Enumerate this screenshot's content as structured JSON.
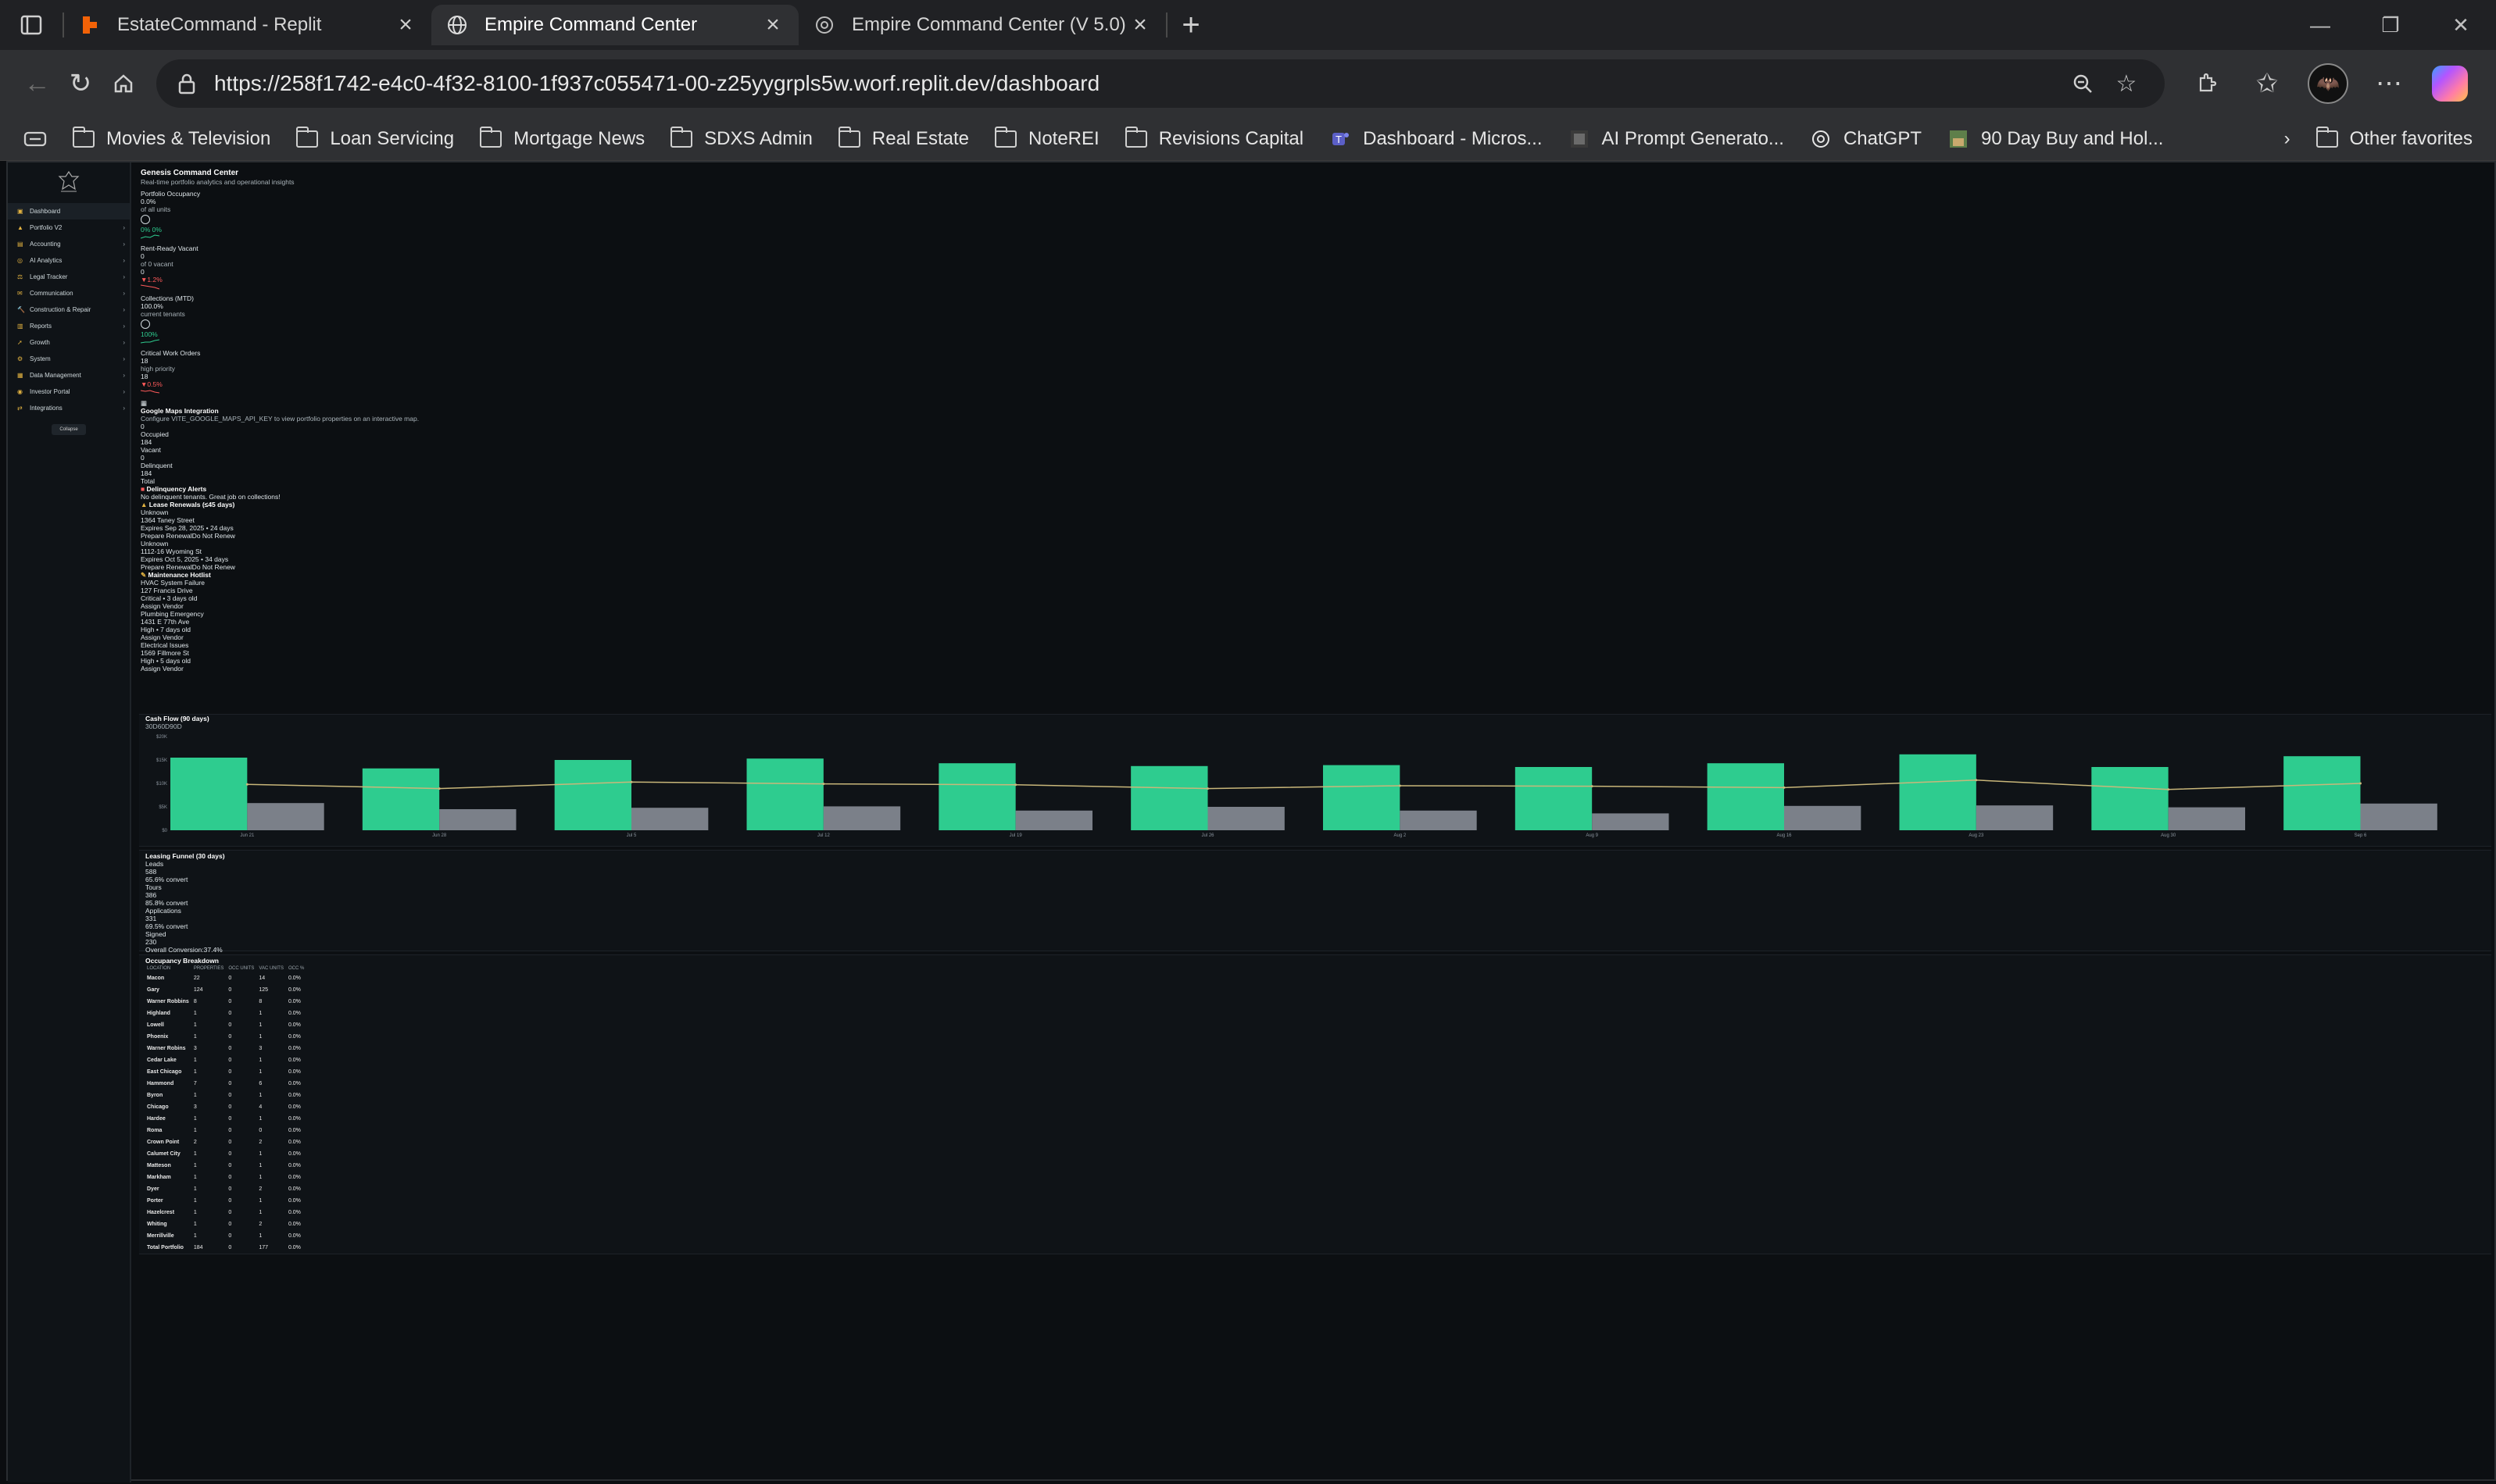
{
  "browser": {
    "tabs": [
      {
        "title": "EstateCommand - Replit",
        "active": false,
        "favicon": "replit-icon"
      },
      {
        "title": "Empire Command Center",
        "active": true,
        "favicon": "globe-icon"
      },
      {
        "title": "Empire Command Center (V 5.0)",
        "active": false,
        "favicon": "openai-icon"
      }
    ],
    "url": "https://258f1742-e4c0-4f32-8100-1f937c055471-00-z25yygrpls5w.worf.replit.dev/dashboard",
    "bookmarks": [
      {
        "label": "Movies & Television",
        "icon": "folder-icon"
      },
      {
        "label": "Loan Servicing",
        "icon": "folder-icon"
      },
      {
        "label": "Mortgage News",
        "icon": "folder-icon"
      },
      {
        "label": "SDXS Admin",
        "icon": "folder-icon"
      },
      {
        "label": "Real Estate",
        "icon": "folder-icon"
      },
      {
        "label": "NoteREI",
        "icon": "folder-icon"
      },
      {
        "label": "Revisions Capital",
        "icon": "folder-icon"
      },
      {
        "label": "Dashboard - Micros...",
        "icon": "teams-icon"
      },
      {
        "label": "AI Prompt Generato...",
        "icon": "image-icon"
      },
      {
        "label": "ChatGPT",
        "icon": "openai-icon"
      },
      {
        "label": "90 Day Buy and Hol...",
        "icon": "image-icon"
      }
    ],
    "other_favorites": "Other favorites"
  },
  "sidebar": {
    "items": [
      {
        "label": "Dashboard",
        "has_children": false
      },
      {
        "label": "Portfolio V2",
        "has_children": true
      },
      {
        "label": "Accounting",
        "has_children": true
      },
      {
        "label": "AI Analytics",
        "has_children": true
      },
      {
        "label": "Legal Tracker",
        "has_children": true
      },
      {
        "label": "Communication",
        "has_children": true
      },
      {
        "label": "Construction & Repair",
        "has_children": true
      },
      {
        "label": "Reports",
        "has_children": true
      },
      {
        "label": "Growth",
        "has_children": true
      },
      {
        "label": "System",
        "has_children": true
      },
      {
        "label": "Data Management",
        "has_children": true
      },
      {
        "label": "Investor Portal",
        "has_children": true
      },
      {
        "label": "Integrations",
        "has_children": true
      }
    ],
    "collapse_label": "Collapse"
  },
  "header": {
    "title": "Genesis Command Center",
    "subtitle": "Real-time portfolio analytics and operational insights"
  },
  "metrics": {
    "occupancy": {
      "label": "Portfolio Occupancy",
      "value": "0.0%",
      "sub": "of all units",
      "delta": "0%",
      "delta_pct": "0%"
    },
    "rent_ready": {
      "label": "Rent-Ready Vacant",
      "value": "0",
      "sub": "of 0 vacant",
      "value2": "0",
      "delta": "▼1.2%"
    },
    "collections": {
      "label": "Collections (MTD)",
      "value": "100.0%",
      "sub": "current tenants",
      "delta": "100%"
    },
    "work_orders": {
      "label": "Critical Work Orders",
      "value": "18",
      "sub": "high priority",
      "value2": "18",
      "delta": "▼0.5%"
    }
  },
  "map": {
    "title": "Google Maps Integration",
    "note": "Configure VITE_GOOGLE_MAPS_API_KEY to view portfolio properties on an interactive map.",
    "legend": [
      {
        "value": "0",
        "label": "Occupied"
      },
      {
        "value": "184",
        "label": "Vacant"
      },
      {
        "value": "0",
        "label": "Delinquent"
      },
      {
        "value": "184",
        "label": "Total"
      }
    ]
  },
  "delinquency": {
    "title": "Delinquency Alerts",
    "message": "No delinquent tenants. Great job on collections!"
  },
  "lease_renewals": {
    "title": "Lease Renewals (≤45 days)",
    "items": [
      {
        "tenant": "Unknown",
        "address": "1364 Taney Street",
        "expires": "Expires Sep 28, 2025 • 24 days",
        "actions": "Prepare RenewalDo Not Renew"
      },
      {
        "tenant": "Unknown",
        "address": "1112-16 Wyoming St",
        "expires": "Expires Oct 5, 2025 • 34 days",
        "actions": "Prepare RenewalDo Not Renew"
      }
    ]
  },
  "maintenance": {
    "title": "Maintenance Hotlist",
    "items": [
      {
        "issue": "HVAC System Failure",
        "address": "127 Francis Drive",
        "meta": "Critical • 3 days old",
        "action": "Assign Vendor"
      },
      {
        "issue": "Plumbing Emergency",
        "address": "1431 E 77th Ave",
        "meta": "High • 7 days old",
        "action": "Assign Vendor"
      },
      {
        "issue": "Electrical Issues",
        "address": "1569 Fillmore St",
        "meta": "High • 5 days old",
        "action": "Assign Vendor"
      }
    ]
  },
  "cashflow": {
    "title": "Cash Flow (90 days)",
    "legend_text": "30D60D90D"
  },
  "chart_data": {
    "type": "bar",
    "title": "Cash Flow (90 days)",
    "categories": [
      "Jun 21",
      "Jun 28",
      "Jul 5",
      "Jul 12",
      "Jul 19",
      "Jul 26",
      "Aug 2",
      "Aug 9",
      "Aug 16",
      "Aug 23",
      "Aug 30",
      "Sep 6"
    ],
    "y_ticks": [
      "$0",
      "$5K",
      "$10K",
      "$15K",
      "$20K"
    ],
    "ylim": [
      0,
      20000
    ],
    "series": [
      {
        "values": [
          15500,
          13200,
          15000,
          15300,
          14300,
          13700,
          13900,
          13500,
          14300,
          16200,
          13500,
          15800
        ],
        "color": "#2ecc8f"
      },
      {
        "values": [
          5800,
          4500,
          4800,
          5100,
          4200,
          5000,
          4200,
          3600,
          5200,
          5300,
          4900,
          5700
        ],
        "color": "#7b8089"
      },
      {
        "values": [
          9800,
          8900,
          10300,
          9900,
          9700,
          8900,
          9500,
          9400,
          9100,
          10700,
          8700,
          10000
        ],
        "color": "#c9b77a",
        "type": "line"
      }
    ],
    "grid": false,
    "legend": "none"
  },
  "funnel": {
    "title": "Leasing Funnel (30 days)",
    "stages": [
      {
        "label": "Leads",
        "value": "588",
        "convert": "65.6% convert"
      },
      {
        "label": "Tours",
        "value": "386",
        "convert": "85.8% convert"
      },
      {
        "label": "Applications",
        "value": "331",
        "convert": "69.5% convert"
      },
      {
        "label": "Signed",
        "value": "230",
        "convert": ""
      }
    ],
    "overall": "Overall Conversion:37.4%"
  },
  "occupancy_breakdown": {
    "title": "Occupancy Breakdown",
    "columns": [
      "LOCATION",
      "PROPERTIES",
      "OCC UNITS",
      "VAC UNITS",
      "OCC %"
    ],
    "rows": [
      [
        "Macon",
        "22",
        "0",
        "14",
        "0.0%"
      ],
      [
        "Gary",
        "124",
        "0",
        "125",
        "0.0%"
      ],
      [
        "Warner Robbins",
        "8",
        "0",
        "8",
        "0.0%"
      ],
      [
        "Highland",
        "1",
        "0",
        "1",
        "0.0%"
      ],
      [
        "Lowell",
        "1",
        "0",
        "1",
        "0.0%"
      ],
      [
        "Phoenix",
        "1",
        "0",
        "1",
        "0.0%"
      ],
      [
        "Warner Robins",
        "3",
        "0",
        "3",
        "0.0%"
      ],
      [
        "Cedar Lake",
        "1",
        "0",
        "1",
        "0.0%"
      ],
      [
        "East Chicago",
        "1",
        "0",
        "1",
        "0.0%"
      ],
      [
        "Hammond",
        "7",
        "0",
        "6",
        "0.0%"
      ],
      [
        "Byron",
        "1",
        "0",
        "1",
        "0.0%"
      ],
      [
        "Chicago",
        "3",
        "0",
        "4",
        "0.0%"
      ],
      [
        "Hardee",
        "1",
        "0",
        "1",
        "0.0%"
      ],
      [
        "Roma",
        "1",
        "0",
        "0",
        "0.0%"
      ],
      [
        "Crown Point",
        "2",
        "0",
        "2",
        "0.0%"
      ],
      [
        "Calumet City",
        "1",
        "0",
        "1",
        "0.0%"
      ],
      [
        "Matteson",
        "1",
        "0",
        "1",
        "0.0%"
      ],
      [
        "Markham",
        "1",
        "0",
        "1",
        "0.0%"
      ],
      [
        "Dyer",
        "1",
        "0",
        "2",
        "0.0%"
      ],
      [
        "Porter",
        "1",
        "0",
        "1",
        "0.0%"
      ],
      [
        "Hazelcrest",
        "1",
        "0",
        "1",
        "0.0%"
      ],
      [
        "Whiting",
        "1",
        "0",
        "2",
        "0.0%"
      ],
      [
        "Merrillville",
        "1",
        "0",
        "1",
        "0.0%"
      ],
      [
        "Total Portfolio",
        "184",
        "0",
        "177",
        "0.0%"
      ]
    ]
  },
  "colors": {
    "accent_green": "#2ecc8f",
    "bar_gray": "#7b8089",
    "line_gold": "#c9b77a",
    "negative": "#ff5a5a",
    "background": "#0c0f12"
  }
}
